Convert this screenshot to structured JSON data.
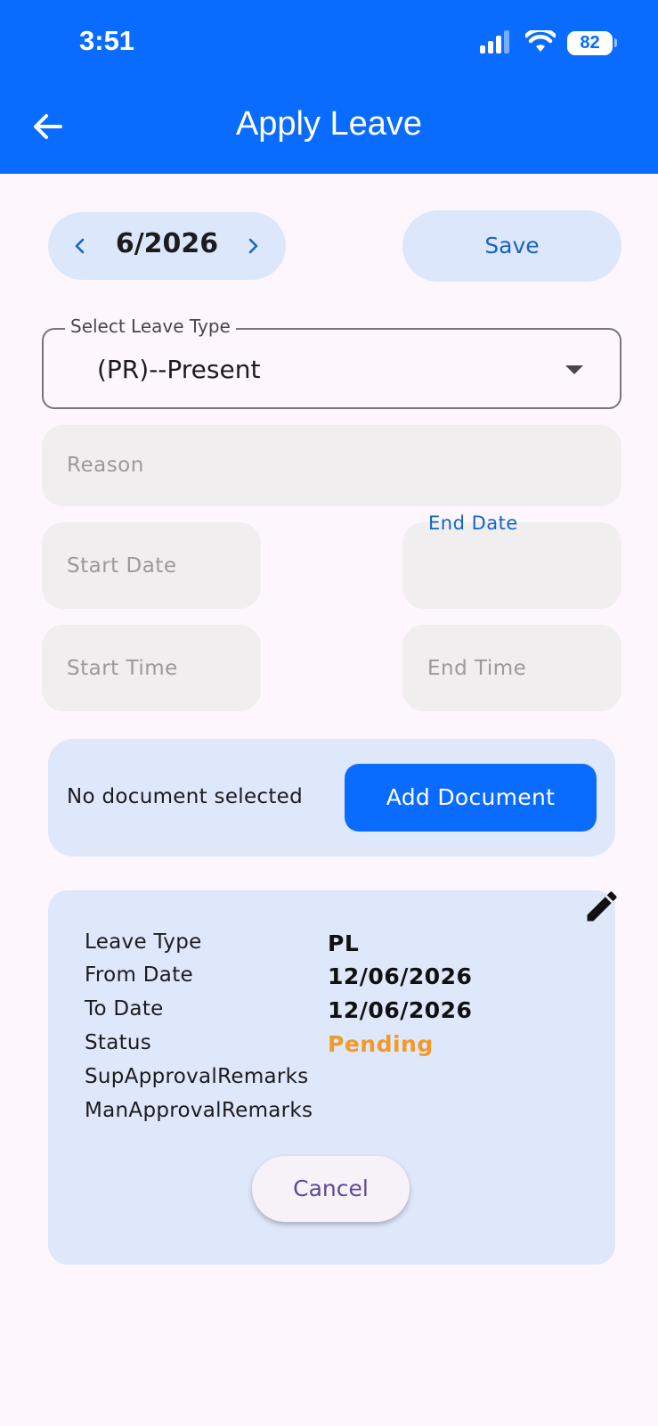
{
  "status_bar": {
    "time": "3:51",
    "battery": "82",
    "icons": [
      "signal-icon",
      "wifi-icon",
      "battery-icon"
    ]
  },
  "app_bar": {
    "title": "Apply Leave",
    "back_icon": "arrow-left-icon",
    "background_color": "#0a6cff"
  },
  "month_nav": {
    "label": "6/2026",
    "prev_icon": "chevron-left-icon",
    "next_icon": "chevron-right-icon"
  },
  "save_label": "Save",
  "leave_type": {
    "label": "Select Leave Type",
    "value": "(PR)--Present",
    "icon": "dropdown-arrow-icon"
  },
  "form": {
    "reason_placeholder": "Reason",
    "start_date_placeholder": "Start Date",
    "end_date_label": "End Date",
    "start_time_placeholder": "Start Time",
    "end_time_placeholder": "End Time"
  },
  "document": {
    "status": "No document selected",
    "add_label": "Add Document"
  },
  "leave_record": {
    "edit_icon": "pencil-icon",
    "rows": [
      {
        "label": "Leave Type",
        "value": "PL"
      },
      {
        "label": "From Date",
        "value": "12/06/2026"
      },
      {
        "label": "To Date",
        "value": "12/06/2026"
      },
      {
        "label": "Status",
        "value": "Pending"
      },
      {
        "label": "SupApprovalRemarks",
        "value": ""
      },
      {
        "label": "ManApprovalRemarks",
        "value": ""
      }
    ],
    "status_color": "#f29a26",
    "cancel_label": "Cancel"
  }
}
